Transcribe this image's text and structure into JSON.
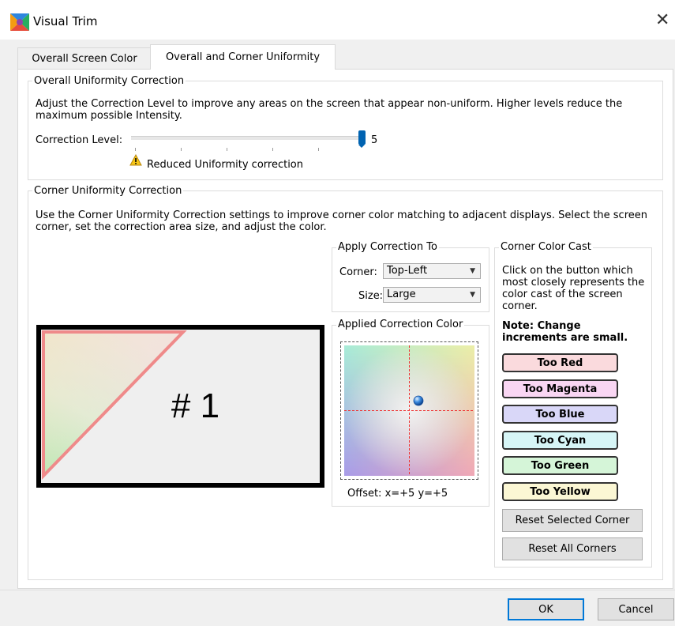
{
  "window": {
    "title": "Visual Trim",
    "close_symbol": "✕"
  },
  "tabs": [
    {
      "label": "Overall Screen Color",
      "active": false
    },
    {
      "label": "Overall and Corner Uniformity",
      "active": true
    }
  ],
  "overall": {
    "legend": "Overall Uniformity Correction",
    "description": "Adjust the Correction Level to improve any areas on the screen that appear non-uniform. Higher levels reduce the maximum possible Intensity.",
    "slider_label": "Correction Level:",
    "slider_value": "5",
    "slider_min": 0,
    "slider_max": 5,
    "warning_text": "Reduced Uniformity correction"
  },
  "corner": {
    "legend": "Corner Uniformity Correction",
    "description": "Use the Corner Uniformity Correction settings to improve corner color matching to adjacent displays. Select the screen corner, set the correction area size, and adjust the color.",
    "display_label": "# 1",
    "apply": {
      "legend": "Apply Correction To",
      "corner_label": "Corner:",
      "corner_value": "Top-Left",
      "size_label": "Size:",
      "size_value": "Large"
    },
    "applied_color": {
      "legend": "Applied Correction Color",
      "offset_text": "Offset: x=+5 y=+5"
    },
    "cast": {
      "legend": "Corner Color Cast",
      "instructions": "Click on the button which most closely represents the color cast of the screen corner.",
      "note": "Note: Change increments are small.",
      "buttons": [
        {
          "label": "Too Red",
          "color": "#fadadd"
        },
        {
          "label": "Too Magenta",
          "color": "#f9d6f3"
        },
        {
          "label": "Too Blue",
          "color": "#d9d7f8"
        },
        {
          "label": "Too Cyan",
          "color": "#d6f5f6"
        },
        {
          "label": "Too Green",
          "color": "#d5f5d8"
        },
        {
          "label": "Too Yellow",
          "color": "#fbf7d4"
        }
      ],
      "reset_selected": "Reset Selected Corner",
      "reset_all": "Reset All Corners"
    }
  },
  "footer": {
    "ok": "OK",
    "cancel": "Cancel"
  }
}
